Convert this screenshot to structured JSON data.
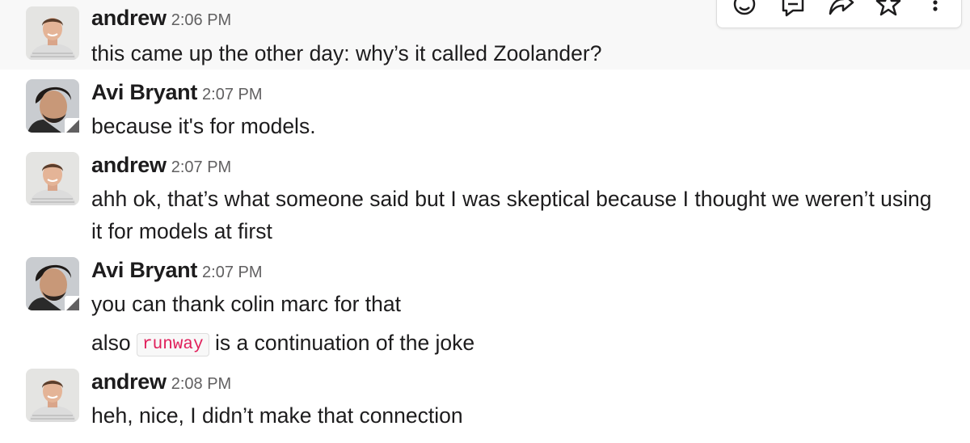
{
  "toolbar": {
    "actions": [
      {
        "icon": "add-reaction-icon"
      },
      {
        "icon": "reply-in-thread-icon"
      },
      {
        "icon": "share-message-icon"
      },
      {
        "icon": "save-star-icon"
      },
      {
        "icon": "more-actions-icon"
      }
    ]
  },
  "messages": [
    {
      "sender": "andrew",
      "time": "2:06 PM",
      "lines": [
        "this came up the other day: why’s it called Zoolander?"
      ]
    },
    {
      "sender": "Avi Bryant",
      "time": "2:07 PM",
      "lines": [
        "because it's for models."
      ]
    },
    {
      "sender": "andrew",
      "time": "2:07 PM",
      "lines": [
        "ahh ok, that’s what someone said but I was skeptical because I thought we weren’t using",
        "it for models at first"
      ]
    },
    {
      "sender": "Avi Bryant",
      "time": "2:07 PM",
      "lines": [
        "you can thank colin marc for that"
      ],
      "followup": {
        "before": "also",
        "code": "runway",
        "after": "is a continuation of the joke"
      }
    },
    {
      "sender": "andrew",
      "time": "2:08 PM",
      "lines": [
        "heh, nice, I didn’t make that connection"
      ]
    }
  ],
  "colors": {
    "text": "#1d1c1d",
    "timestamp": "#616061",
    "hover_background": "#f8f8f8",
    "code_text": "#e01e5a"
  }
}
